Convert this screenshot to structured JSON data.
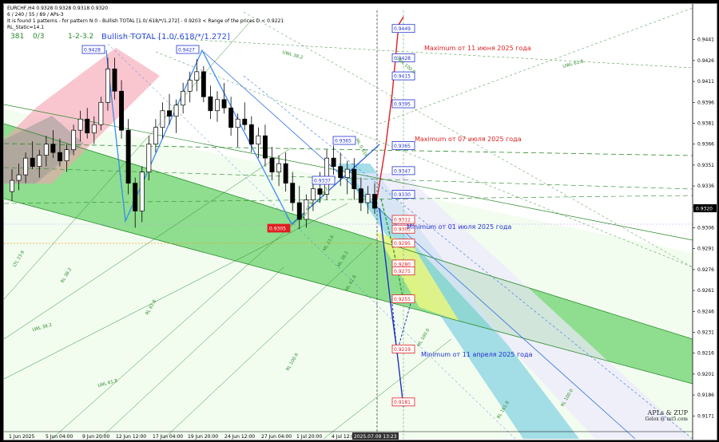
{
  "header": {
    "symbol_line": "EURCHF,H4  0.9328 0.9328 0.9318 0.9320",
    "params_line": "6 / 240 / 55 / 89 / APs-3",
    "pattern_line": "It is found 1 patterns  -  for pattern N 0 - Bullish TOTAL [1.0/.618/*/1.272] - 0.9203 < Range of the prices D < 0.9221",
    "static_line": "RL_Static=14.1",
    "count_a": "381",
    "count_b": "0/3",
    "count_c": "1-2-3.2"
  },
  "chart_data": {
    "type": "candlestick",
    "title": "Bullish TOTAL [1.0/.618/*/1.272]",
    "ylim": [
      0.9162,
      0.9462
    ],
    "yticks": [
      "0.9441",
      "0.9426",
      "0.9411",
      "0.9396",
      "0.9381",
      "0.9366",
      "0.9351",
      "0.9336",
      "0.9321",
      "0.9306",
      "0.9291",
      "0.9276",
      "0.9261",
      "0.9246",
      "0.9231",
      "0.9216",
      "0.9201",
      "0.9186",
      "0.9171"
    ],
    "current_price": "0.9320",
    "xticks": [
      "1 Jun 2025",
      "5 Jun 04:00",
      "9 Jun 20:00",
      "12 Jun 12:00",
      "17 Jun 04:00",
      "19 Jun 20:00",
      "24 Jun 12:00",
      "27 Jun 04:00",
      "1 Jul 20:00",
      "4 Jul 12:00",
      "2025.07.09 13:23"
    ],
    "candles": [
      [
        0.9332,
        0.9348,
        0.9325,
        0.934
      ],
      [
        0.934,
        0.9352,
        0.9333,
        0.9344
      ],
      [
        0.9344,
        0.936,
        0.9338,
        0.9356
      ],
      [
        0.9356,
        0.9368,
        0.9348,
        0.935
      ],
      [
        0.935,
        0.9362,
        0.9342,
        0.9358
      ],
      [
        0.9358,
        0.9372,
        0.935,
        0.9366
      ],
      [
        0.9366,
        0.9376,
        0.9356,
        0.936
      ],
      [
        0.936,
        0.937,
        0.935,
        0.9354
      ],
      [
        0.9354,
        0.9366,
        0.9346,
        0.9362
      ],
      [
        0.9362,
        0.938,
        0.9358,
        0.9376
      ],
      [
        0.9376,
        0.939,
        0.9368,
        0.9384
      ],
      [
        0.9384,
        0.9392,
        0.937,
        0.9374
      ],
      [
        0.9374,
        0.9386,
        0.9366,
        0.938
      ],
      [
        0.938,
        0.94,
        0.9376,
        0.9396
      ],
      [
        0.9396,
        0.9428,
        0.939,
        0.942
      ],
      [
        0.942,
        0.9428,
        0.9398,
        0.9404
      ],
      [
        0.9404,
        0.9412,
        0.937,
        0.9376
      ],
      [
        0.9376,
        0.9384,
        0.933,
        0.9338
      ],
      [
        0.9338,
        0.9342,
        0.9306,
        0.9318
      ],
      [
        0.9318,
        0.935,
        0.931,
        0.9346
      ],
      [
        0.9346,
        0.9372,
        0.934,
        0.9366
      ],
      [
        0.9366,
        0.9384,
        0.936,
        0.9378
      ],
      [
        0.9378,
        0.9396,
        0.937,
        0.939
      ],
      [
        0.939,
        0.9402,
        0.938,
        0.9386
      ],
      [
        0.9386,
        0.9398,
        0.9374,
        0.9394
      ],
      [
        0.9394,
        0.941,
        0.9388,
        0.9404
      ],
      [
        0.9404,
        0.9418,
        0.9396,
        0.9412
      ],
      [
        0.9412,
        0.9427,
        0.9404,
        0.9418
      ],
      [
        0.9418,
        0.9422,
        0.9396,
        0.94
      ],
      [
        0.94,
        0.9408,
        0.9384,
        0.939
      ],
      [
        0.939,
        0.9404,
        0.9382,
        0.9398
      ],
      [
        0.9398,
        0.941,
        0.9388,
        0.9392
      ],
      [
        0.9392,
        0.94,
        0.9372,
        0.9378
      ],
      [
        0.9378,
        0.9388,
        0.9364,
        0.9384
      ],
      [
        0.9384,
        0.9396,
        0.9376,
        0.938
      ],
      [
        0.938,
        0.9386,
        0.936,
        0.9366
      ],
      [
        0.9366,
        0.9378,
        0.9356,
        0.9372
      ],
      [
        0.9372,
        0.938,
        0.935,
        0.9356
      ],
      [
        0.9356,
        0.9364,
        0.934,
        0.9346
      ],
      [
        0.9346,
        0.9358,
        0.9336,
        0.9352
      ],
      [
        0.9352,
        0.936,
        0.9332,
        0.9338
      ],
      [
        0.9338,
        0.9346,
        0.9318,
        0.9324
      ],
      [
        0.9324,
        0.9336,
        0.9305,
        0.9312
      ],
      [
        0.9312,
        0.933,
        0.9306,
        0.9326
      ],
      [
        0.9326,
        0.934,
        0.9318,
        0.9334
      ],
      [
        0.9334,
        0.9346,
        0.9324,
        0.933
      ],
      [
        0.933,
        0.9362,
        0.9326,
        0.9356
      ],
      [
        0.9356,
        0.9365,
        0.9344,
        0.935
      ],
      [
        0.935,
        0.936,
        0.9336,
        0.9342
      ],
      [
        0.9342,
        0.9354,
        0.933,
        0.9348
      ],
      [
        0.9348,
        0.9356,
        0.9326,
        0.9334
      ],
      [
        0.9334,
        0.9342,
        0.9318,
        0.9324
      ],
      [
        0.9324,
        0.9336,
        0.9316,
        0.933
      ],
      [
        0.933,
        0.9338,
        0.9316,
        0.932
      ]
    ],
    "levels": [
      {
        "label": "0.9449",
        "style": "blue"
      },
      {
        "label": "0.9428",
        "style": "blue"
      },
      {
        "label": "0.9415",
        "style": "blue"
      },
      {
        "label": "0.9395",
        "style": "blue"
      },
      {
        "label": "0.9365",
        "style": "blue"
      },
      {
        "label": "0.9347",
        "style": "blue"
      },
      {
        "label": "0.9330",
        "style": "blue"
      },
      {
        "label": "0.9312",
        "style": "red"
      },
      {
        "label": "0.9305",
        "style": "red"
      },
      {
        "label": "0.9295",
        "style": "red"
      },
      {
        "label": "0.9280",
        "style": "red"
      },
      {
        "label": "0.9275",
        "style": "red"
      },
      {
        "label": "0.9255",
        "style": "red"
      },
      {
        "label": "0.9219",
        "style": "red"
      },
      {
        "label": "0.9181",
        "style": "red"
      }
    ],
    "pivot_labels": [
      {
        "label": "0.9428",
        "style": "blue"
      },
      {
        "label": "0.9427",
        "style": "blue"
      },
      {
        "label": "0.9365",
        "style": "blue"
      },
      {
        "label": "0.9337",
        "style": "blue"
      },
      {
        "label": "0.9305",
        "style": "red"
      }
    ],
    "annotations": [
      {
        "text": "Maximum от 11 июня 2025 года",
        "color": "#e02020"
      },
      {
        "text": "Maximum от 07 июля 2025 года",
        "color": "#e02020"
      },
      {
        "text": "Minimum от 01 июля 2025 года",
        "color": "#2030d0"
      },
      {
        "text": "Minimum от 11 апреля 2025 года",
        "color": "#2030d0"
      }
    ],
    "line_labels": [
      "UWL 38.2",
      "UWL 100.0",
      "UWL 61.8",
      "LWL 38.2",
      "LWL 61.8",
      "LTL 23.6",
      "RL 38.2",
      "RL 61.8",
      "RL 100.0",
      "ML 0.618",
      "ML 23.6",
      "ML 38.2",
      "ML 61.8",
      "ML 100.0",
      "ML 38.2",
      "ML 61.8",
      "RL 100.0",
      "RL 161.8"
    ],
    "grid": false,
    "legend": "none"
  },
  "watermark": {
    "line1": "APLs & ZUP",
    "line2": "Gelox @ mt5.com"
  }
}
